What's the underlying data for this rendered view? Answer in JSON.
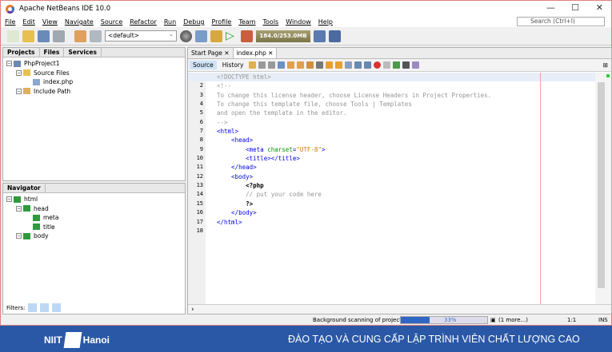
{
  "title": "Apache NetBeans IDE 10.0",
  "menu": [
    "File",
    "Edit",
    "View",
    "Navigate",
    "Source",
    "Refactor",
    "Run",
    "Debug",
    "Profile",
    "Team",
    "Tools",
    "Window",
    "Help"
  ],
  "search_placeholder": "Search (Ctrl+I)",
  "config": "<default>",
  "memory": "184.0/253.0MB",
  "projects_tabs": [
    "Projects",
    "Files",
    "Services"
  ],
  "project_tree": [
    {
      "label": "PhpProject1",
      "level": 0
    },
    {
      "label": "Source Files",
      "level": 1
    },
    {
      "label": "index.php",
      "level": 2
    },
    {
      "label": "Include Path",
      "level": 1
    }
  ],
  "navigator": {
    "title": "Navigator",
    "items": [
      {
        "label": "html",
        "level": 0
      },
      {
        "label": "head",
        "level": 1
      },
      {
        "label": "meta",
        "level": 2
      },
      {
        "label": "title",
        "level": 2
      },
      {
        "label": "body",
        "level": 1
      }
    ]
  },
  "filters_label": "Filters:",
  "editor_tabs": [
    "Start Page",
    "index.php"
  ],
  "editor_modes": [
    "Source",
    "History"
  ],
  "code": [
    "<!DOCTYPE html>",
    "<!--",
    "To change this license header, choose License Headers in Project Properties.",
    "To change this template file, choose Tools | Templates",
    "and open the template in the editor.",
    "-->",
    "<html>",
    "    <head>",
    "        <meta charset=\"UTF-8\">",
    "        <title></title>",
    "    </head>",
    "    <body>",
    "        <?php",
    "        // put your code here",
    "        ?>",
    "    </body>",
    "</html>",
    ""
  ],
  "status": {
    "scan": "Background scanning of projects...",
    "progress_label": "33%",
    "progress": 0.33,
    "more": "(1 more...)",
    "position": "1:1",
    "mode": "INS"
  },
  "banner": {
    "logo_left": "NIIT",
    "logo_right": "Hanoi",
    "slogan": "ĐÀO TẠO VÀ CUNG CẤP LẬP TRÌNH VIÊN CHẤT LƯỢNG CAO"
  }
}
